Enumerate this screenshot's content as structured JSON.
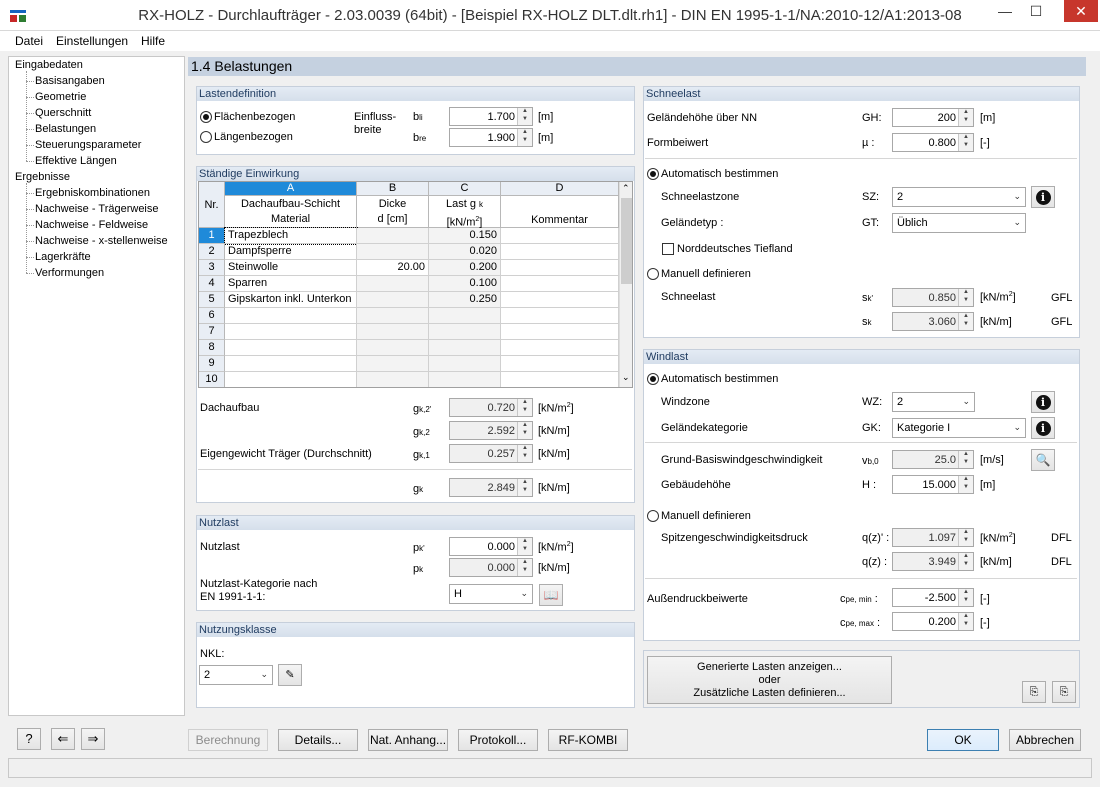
{
  "window": {
    "title": "RX-HOLZ - Durchlaufträger - 2.03.0039 (64bit) - [Beispiel RX-HOLZ DLT.dlt.rh1] - DIN EN 1995-1-1/NA:2010-12/A1:2013-08"
  },
  "menu": [
    "Datei",
    "Einstellungen",
    "Hilfe"
  ],
  "nav": {
    "input_root": "Eingabedaten",
    "input_items": [
      "Basisangaben",
      "Geometrie",
      "Querschnitt",
      "Belastungen",
      "Steuerungsparameter",
      "Effektive Längen"
    ],
    "results_root": "Ergebnisse",
    "results_items": [
      "Ergebniskombinationen",
      "Nachweise - Trägerweise",
      "Nachweise - Feldweise",
      "Nachweise - x-stellenweise",
      "Lagerkräfte",
      "Verformungen"
    ]
  },
  "page_title": "1.4 Belastungen",
  "lastdefinition": {
    "title": "Lastendefinition",
    "opt_area": "Flächenbezogen",
    "opt_length": "Längenbezogen",
    "einfluss_label_1": "Einfluss-",
    "einfluss_label_2": "breite",
    "bli_sym": "b",
    "bli_sub": "li",
    "bli_val": "1.700",
    "bre_sym": "b",
    "bre_sub": "re",
    "bre_val": "1.900",
    "unit": "[m]",
    "selected": "Flächenbezogen"
  },
  "staendig": {
    "title": "Ständige Einwirkung",
    "col_letters": [
      "A",
      "B",
      "C",
      "D"
    ],
    "h_nr": "Nr.",
    "h_a1": "Dachaufbau-Schicht",
    "h_a2": "Material",
    "h_b1": "Dicke",
    "h_b2": "d [cm]",
    "h_c1": "Last g",
    "h_c1sub": "k",
    "h_c2": "[kN/m",
    "h_c2sup": "2",
    "h_c2end": "]",
    "h_d": "Kommentar",
    "rows": [
      {
        "nr": "1",
        "material": "Trapezblech",
        "dicke": "",
        "last": "0.150",
        "kommentar": ""
      },
      {
        "nr": "2",
        "material": "Dampfsperre",
        "dicke": "",
        "last": "0.020",
        "kommentar": ""
      },
      {
        "nr": "3",
        "material": "Steinwolle",
        "dicke": "20.00",
        "last": "0.200",
        "kommentar": ""
      },
      {
        "nr": "4",
        "material": "Sparren",
        "dicke": "",
        "last": "0.100",
        "kommentar": ""
      },
      {
        "nr": "5",
        "material": "Gipskarton inkl. Unterkon",
        "dicke": "",
        "last": "0.250",
        "kommentar": ""
      },
      {
        "nr": "6",
        "material": "",
        "dicke": "",
        "last": "",
        "kommentar": ""
      },
      {
        "nr": "7",
        "material": "",
        "dicke": "",
        "last": "",
        "kommentar": ""
      },
      {
        "nr": "8",
        "material": "",
        "dicke": "",
        "last": "",
        "kommentar": ""
      },
      {
        "nr": "9",
        "material": "",
        "dicke": "",
        "last": "",
        "kommentar": ""
      },
      {
        "nr": "10",
        "material": "",
        "dicke": "",
        "last": "",
        "kommentar": ""
      }
    ],
    "dachaufbau_label": "Dachaufbau",
    "gk2p_sym": "g",
    "gk2p_sub": "k,2'",
    "gk2p_val": "0.720",
    "gk2p_unit": "[kN/m",
    "gk2p_unit_sup": "2",
    "gk2p_unit_end": "]",
    "gk2_sym": "g",
    "gk2_sub": "k,2",
    "gk2_val": "2.592",
    "gk2_unit": "[kN/m]",
    "eigengewicht_label": "Eigengewicht Träger (Durchschnitt)",
    "gk1_sym": "g",
    "gk1_sub": "k,1",
    "gk1_val": "0.257",
    "gk1_unit": "[kN/m]",
    "gk_sym": "g",
    "gk_sub": "k",
    "gk_val": "2.849",
    "gk_unit": "[kN/m]"
  },
  "nutzlast": {
    "title": "Nutzlast",
    "label": "Nutzlast",
    "pkp_sym": "p",
    "pkp_sub": "k'",
    "pkp_val": "0.000",
    "pkp_unit": "[kN/m",
    "pkp_unit_sup": "2",
    "pkp_unit_end": "]",
    "pk_sym": "p",
    "pk_sub": "k",
    "pk_val": "0.000",
    "pk_unit": "[kN/m]",
    "kat_label_1": "Nutzlast-Kategorie nach",
    "kat_label_2": "EN 1991-1-1:",
    "kat_val": "H"
  },
  "nutzungsklasse": {
    "title": "Nutzungsklasse",
    "nkl_label": "NKL:",
    "nkl_val": "2"
  },
  "schnee": {
    "title": "Schneelast",
    "gh_label": "Geländehöhe über NN",
    "gh_sym": "GH:",
    "gh_val": "200",
    "gh_unit": "[m]",
    "mu_label": "Formbeiwert",
    "mu_sym": "µ :",
    "mu_val": "0.800",
    "mu_unit": "[-]",
    "auto_label": "Automatisch bestimmen",
    "sz_label": "Schneelastzone",
    "sz_sym": "SZ:",
    "sz_val": "2",
    "gt_label": "Geländetyp :",
    "gt_sym": "GT:",
    "gt_val": "Üblich",
    "nordd_label": "Norddeutsches Tiefland",
    "manual_label": "Manuell definieren",
    "schneelast_label": "Schneelast",
    "skp_sym": "s",
    "skp_sub": "k'",
    "skp_val": "0.850",
    "skp_unit": "[kN/m",
    "skp_unit_sup": "2",
    "skp_unit_end": "]",
    "skp_tag": "GFL",
    "sk_sym": "s",
    "sk_sub": "k",
    "sk_val": "3.060",
    "sk_unit": "[kN/m]",
    "sk_tag": "GFL",
    "selected": "Automatisch bestimmen"
  },
  "wind": {
    "title": "Windlast",
    "auto_label": "Automatisch bestimmen",
    "wz_label": "Windzone",
    "wz_sym": "WZ:",
    "wz_val": "2",
    "gk_label": "Geländekategorie",
    "gk_sym": "GK:",
    "gk_val": "Kategorie I",
    "vb_label": "Grund-Basiswindgeschwindigkeit",
    "vb_sym": "v",
    "vb_sub": "b,0",
    "vb_val": "25.0",
    "vb_unit": "[m/s]",
    "h_label": "Gebäudehöhe",
    "h_sym": "H :",
    "h_val": "15.000",
    "h_unit": "[m]",
    "manual_label": "Manuell definieren",
    "q_label": "Spitzengeschwindigkeitsdruck",
    "qp_sym": "q(z)' :",
    "qp_val": "1.097",
    "qp_unit": "[kN/m",
    "qp_unit_sup": "2",
    "qp_unit_end": "]",
    "qp_tag": "DFL",
    "q_sym": "q(z) :",
    "q_val": "3.949",
    "q_unit": "[kN/m]",
    "q_tag": "DFL",
    "cpe_label": "Außendruckbeiwerte",
    "cpemin_sym": "c",
    "cpemin_sub": "pe, min",
    "cpemin_val": "-2.500",
    "cpemin_unit": "[-]",
    "cpemax_sym": "c",
    "cpemax_sub": "pe, max",
    "cpemax_val": "0.200",
    "cpemax_unit": "[-]",
    "selected": "Automatisch bestimmen"
  },
  "generate_btn": {
    "line1": "Generierte Lasten anzeigen...",
    "line2": "oder",
    "line3": "Zusätzliche Lasten definieren..."
  },
  "footer": {
    "berechnung": "Berechnung",
    "details": "Details...",
    "nat_anhang": "Nat. Anhang...",
    "protokoll": "Protokoll...",
    "rfkombi": "RF-KOMBI",
    "ok": "OK",
    "abbrechen": "Abbrechen"
  },
  "colors": {
    "header_bg": "#c5d1e0",
    "selection": "#1f8ad9",
    "close": "#c7362c"
  }
}
